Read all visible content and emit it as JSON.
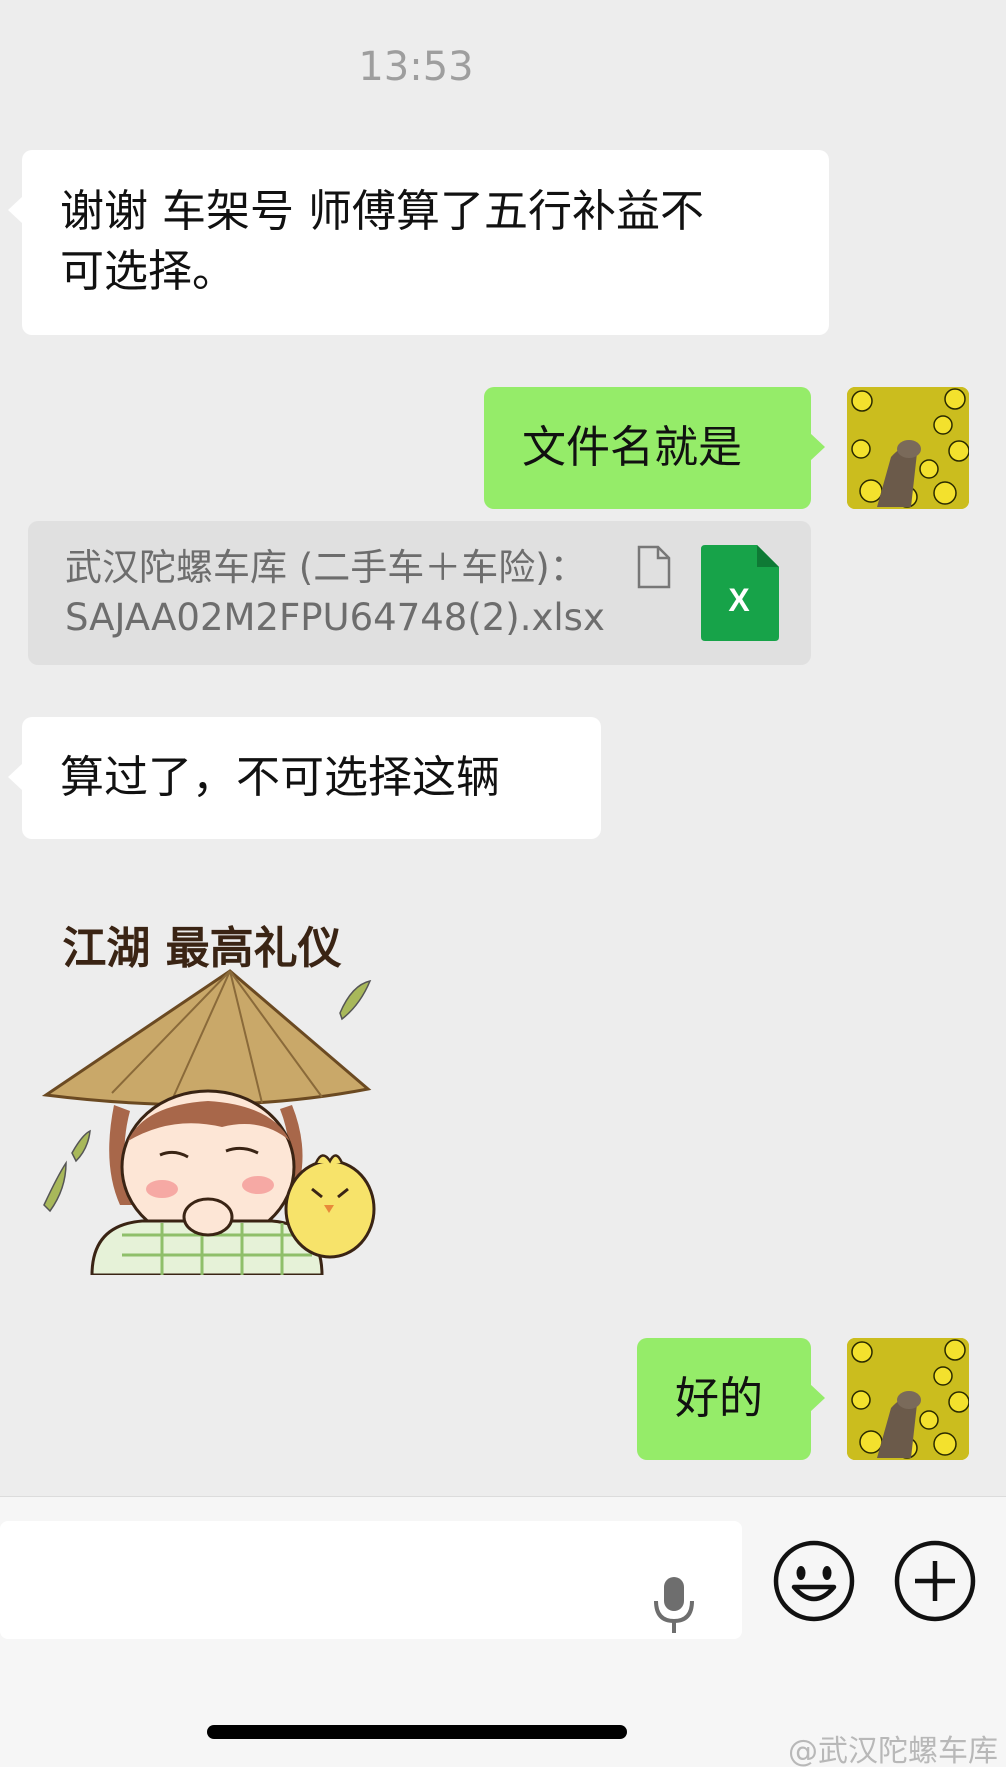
{
  "chat": {
    "timestamp": "13:53",
    "messages": [
      {
        "from": "contact",
        "type": "text",
        "text": "谢谢 车架号 师傅算了五行补益不可选择。",
        "lines": [
          "谢谢 车架号 师傅算了五行补益不",
          "可选择。"
        ]
      },
      {
        "from": "me",
        "type": "text",
        "text": "文件名就是"
      },
      {
        "from": "me",
        "type": "file",
        "line1": "武汉陀螺车库 (二手车＋车险)：",
        "line2": "SAJAA02M2FPU64748(2).xlsx",
        "icon": "excel-file-icon",
        "icon_label": "X"
      },
      {
        "from": "contact",
        "type": "text",
        "text": "算过了，不可选择这辆"
      },
      {
        "from": "contact",
        "type": "sticker",
        "caption": "江湖 最高礼仪"
      },
      {
        "from": "me",
        "type": "text",
        "text": "好的"
      }
    ]
  },
  "input_bar": {
    "voice_icon": "microphone-icon",
    "emoji_icon": "smiley-face-icon",
    "more_icon": "plus-circle-icon"
  },
  "watermark": "@武汉陀螺车库",
  "colors": {
    "background": "#ededed",
    "incoming_bubble": "#ffffff",
    "outgoing_bubble": "#95ec69",
    "excel_green": "#17a349"
  }
}
